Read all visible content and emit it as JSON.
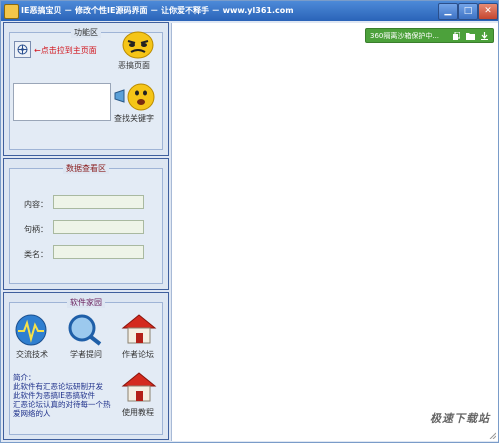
{
  "window": {
    "title": "IE恶搞宝贝 － 修改个性IE源码界面 － 让你爱不释手 － www.yl361.com"
  },
  "function_area": {
    "legend": "功能区",
    "hint": "←点击拉到主页面",
    "prank_page_label": "恶搞页面",
    "find_keyword_label": "查找关键字"
  },
  "data_view": {
    "legend": "数据查看区",
    "fields": [
      {
        "label": "内容：",
        "value": ""
      },
      {
        "label": "句柄：",
        "value": ""
      },
      {
        "label": "类名：",
        "value": ""
      }
    ]
  },
  "software_home": {
    "legend": "软件家园",
    "items": [
      {
        "label": "交流技术"
      },
      {
        "label": "学者提问"
      },
      {
        "label": "作者论坛"
      }
    ],
    "intro_lines": [
      "简介：",
      "此软件有汇恶论坛研制开发",
      "此软件为恶搞IE恶搞软件",
      "汇恶论坛认真的对待每一个热",
      "爱网络的人"
    ],
    "tutorial_label": "使用教程"
  },
  "browser": {
    "security_bar_text": "360隔离沙箱保护中..."
  },
  "watermark": "极速下载站",
  "colors": {
    "titlebar": "#2a63b8",
    "security_green": "#4ca13b",
    "hint_red": "#d2141c"
  }
}
